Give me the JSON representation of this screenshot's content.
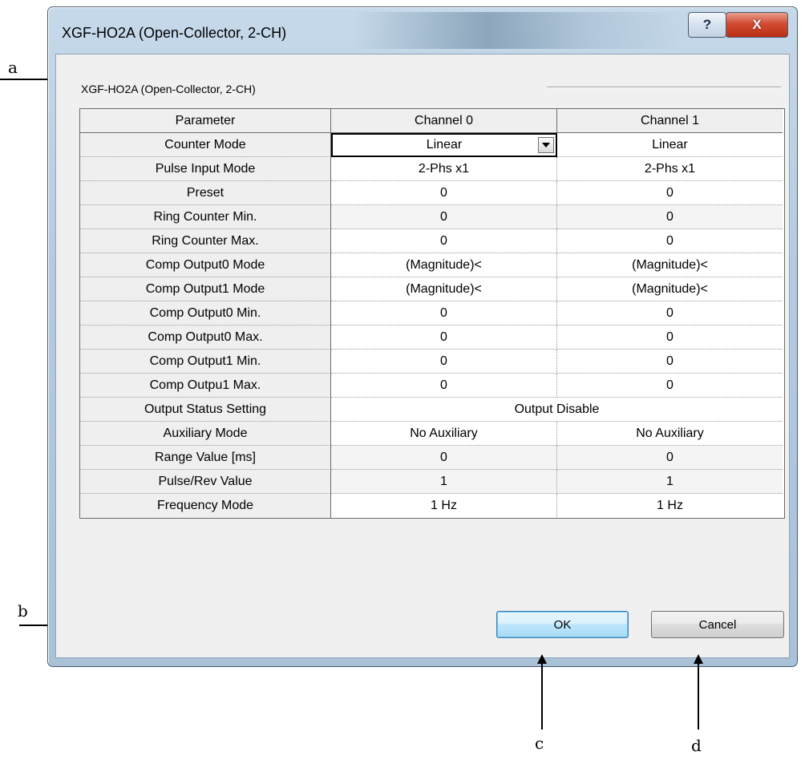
{
  "window": {
    "title": "XGF-HO2A (Open-Collector, 2-CH)",
    "help_glyph": "?",
    "close_glyph": "X"
  },
  "group": {
    "label": "XGF-HO2A (Open-Collector, 2-CH)"
  },
  "table": {
    "headers": [
      "Parameter",
      "Channel 0",
      "Channel 1"
    ],
    "rows": [
      {
        "param": "Counter Mode",
        "ch0": "Linear",
        "ch1": "Linear"
      },
      {
        "param": "Pulse Input Mode",
        "ch0": "2-Phs x1",
        "ch1": "2-Phs x1"
      },
      {
        "param": "Preset",
        "ch0": "0",
        "ch1": "0"
      },
      {
        "param": "Ring Counter Min.",
        "ch0": "0",
        "ch1": "0"
      },
      {
        "param": "Ring Counter Max.",
        "ch0": "0",
        "ch1": "0"
      },
      {
        "param": "Comp Output0 Mode",
        "ch0": "(Magnitude)<",
        "ch1": "(Magnitude)<"
      },
      {
        "param": "Comp Output1 Mode",
        "ch0": "(Magnitude)<",
        "ch1": "(Magnitude)<"
      },
      {
        "param": "Comp Output0 Min.",
        "ch0": "0",
        "ch1": "0"
      },
      {
        "param": "Comp Output0 Max.",
        "ch0": "0",
        "ch1": "0"
      },
      {
        "param": "Comp Output1 Min.",
        "ch0": "0",
        "ch1": "0"
      },
      {
        "param": "Comp Outpu1 Max.",
        "ch0": "0",
        "ch1": "0"
      },
      {
        "param": "Output Status Setting",
        "span": "Output Disable"
      },
      {
        "param": "Auxiliary Mode",
        "ch0": "No Auxiliary",
        "ch1": "No Auxiliary"
      },
      {
        "param": "Range Value [ms]",
        "ch0": "0",
        "ch1": "0"
      },
      {
        "param": "Pulse/Rev Value",
        "ch0": "1",
        "ch1": "1"
      },
      {
        "param": "Frequency Mode",
        "ch0": "1 Hz",
        "ch1": "1 Hz"
      }
    ]
  },
  "buttons": {
    "ok": "OK",
    "cancel": "Cancel"
  },
  "annotations": {
    "a": "a",
    "b": "b",
    "c": "c",
    "d": "d"
  }
}
